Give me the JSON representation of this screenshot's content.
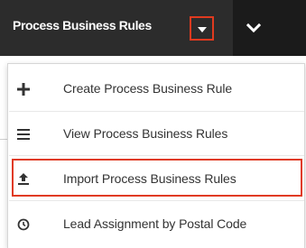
{
  "header": {
    "tab_label": "Process Business Rules",
    "tab_menu_icon": "caret-down-icon",
    "more_icon": "chevron-down-icon"
  },
  "menu": {
    "items": [
      {
        "label": "Create Process Business Rule",
        "icon": "plus-icon"
      },
      {
        "label": "View Process Business Rules",
        "icon": "list-icon"
      },
      {
        "label": "Import Process Business Rules",
        "icon": "upload-icon"
      },
      {
        "label": "Lead Assignment by Postal Code",
        "icon": "clock-icon"
      }
    ]
  },
  "colors": {
    "header_background": "#1b1b1b",
    "tab_background": "#2c2c2c",
    "highlight": "#e03a1f",
    "menu_text": "#333333"
  }
}
